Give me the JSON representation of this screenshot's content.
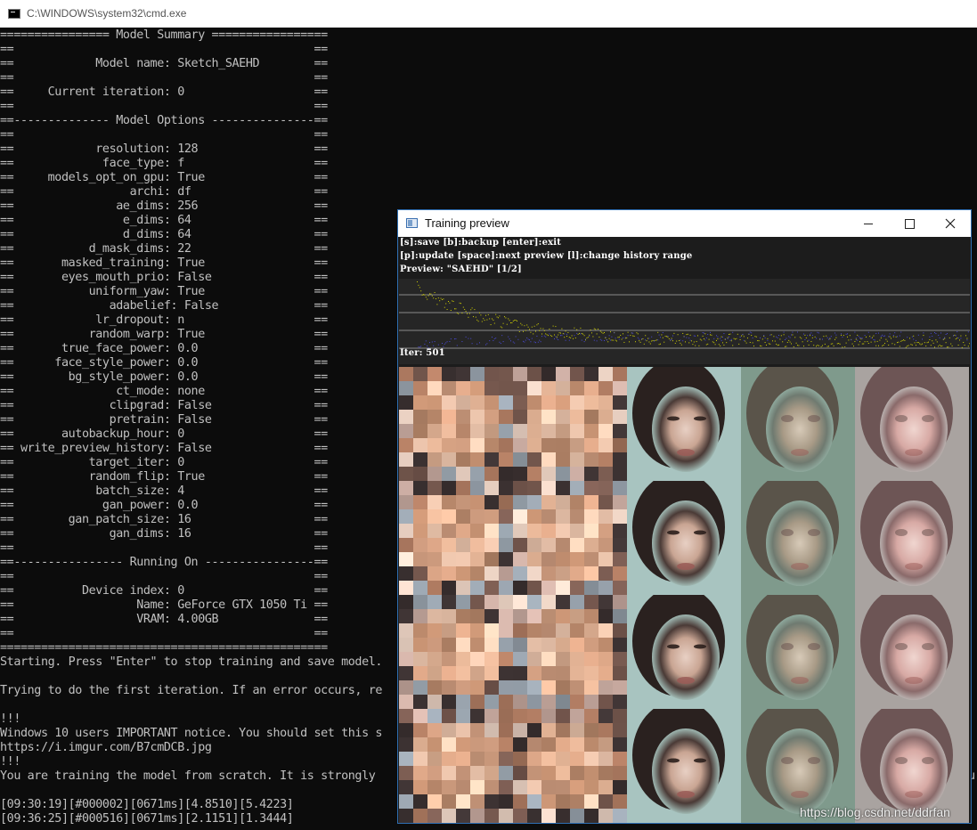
{
  "cmd_window": {
    "title": "C:\\WINDOWS\\system32\\cmd.exe"
  },
  "console_lines": [
    "================ Model Summary =================",
    "==                                            ==",
    "==            Model name: Sketch_SAEHD        ==",
    "==                                            ==",
    "==     Current iteration: 0                   ==",
    "==                                            ==",
    "==-------------- Model Options ---------------==",
    "==                                            ==",
    "==            resolution: 128                 ==",
    "==             face_type: f                   ==",
    "==     models_opt_on_gpu: True                ==",
    "==                 archi: df                  ==",
    "==               ae_dims: 256                 ==",
    "==                e_dims: 64                  ==",
    "==                d_dims: 64                  ==",
    "==           d_mask_dims: 22                  ==",
    "==       masked_training: True                ==",
    "==       eyes_mouth_prio: False               ==",
    "==           uniform_yaw: True                ==",
    "==              adabelief: False              ==",
    "==            lr_dropout: n                   ==",
    "==           random_warp: True                ==",
    "==       true_face_power: 0.0                 ==",
    "==      face_style_power: 0.0                 ==",
    "==        bg_style_power: 0.0                 ==",
    "==               ct_mode: none                ==",
    "==              clipgrad: False               ==",
    "==              pretrain: False               ==",
    "==       autobackup_hour: 0                   ==",
    "== write_preview_history: False               ==",
    "==           target_iter: 0                   ==",
    "==           random_flip: True                ==",
    "==            batch_size: 4                   ==",
    "==             gan_power: 0.0                 ==",
    "==        gan_patch_size: 16                  ==",
    "==              gan_dims: 16                  ==",
    "==                                            ==",
    "==---------------- Running On ----------------==",
    "==                                            ==",
    "==          Device index: 0                   ==",
    "==                  Name: GeForce GTX 1050 Ti ==",
    "==                  VRAM: 4.00GB              ==",
    "==                                            ==",
    "================================================",
    "Starting. Press \"Enter\" to stop training and save model.",
    "",
    "Trying to do the first iteration. If an error occurs, re",
    "",
    "!!!",
    "Windows 10 users IMPORTANT notice. You should set this s",
    "https://i.imgur.com/B7cmDCB.jpg",
    "!!!",
    "You are training the model from scratch. It is strongly",
    "",
    "[09:30:19][#000002][0671ms][4.8510][5.4223]",
    "[09:36:25][#000516][0671ms][2.1151][1.3444]"
  ],
  "console_right_edge_char": "u",
  "preview_window": {
    "title": "Training preview",
    "help_line_1": "[s]:save [b]:backup [enter]:exit",
    "help_line_2": "[p]:update [space]:next preview [l]:change history range",
    "preview_label": "Preview: \"SAEHD\" [1/2]",
    "iter_label": "Iter: 501",
    "loss_colors": {
      "src": "#d4d400",
      "dst": "#4a4ad8"
    }
  },
  "watermark": "https://blog.csdn.net/ddrfan",
  "colors": {
    "console_bg": "#0c0c0c",
    "console_text": "#c0c0c0",
    "window_accent": "#2f6fb3"
  }
}
